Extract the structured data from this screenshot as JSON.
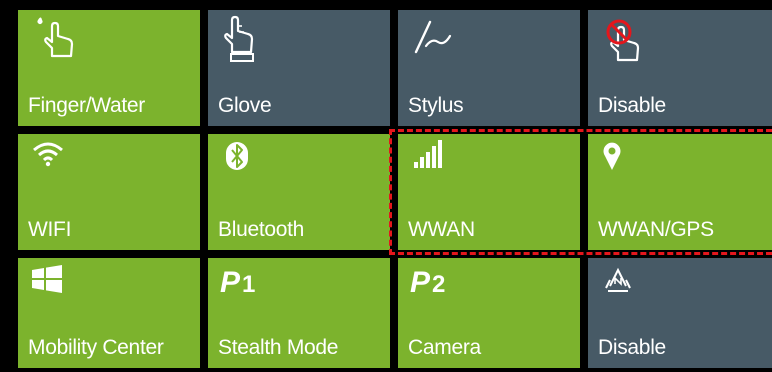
{
  "tiles": {
    "row1": [
      {
        "label": "Finger/Water",
        "icon": "finger-water-icon"
      },
      {
        "label": "Glove",
        "icon": "glove-hand-icon"
      },
      {
        "label": "Stylus",
        "icon": "stylus-icon"
      },
      {
        "label": "Disable",
        "icon": "touch-disabled-icon"
      }
    ],
    "row2": [
      {
        "label": "WIFI",
        "icon": "wifi-icon"
      },
      {
        "label": "Bluetooth",
        "icon": "bluetooth-icon"
      },
      {
        "label": "WWAN",
        "icon": "signal-bars-icon"
      },
      {
        "label": "WWAN/GPS",
        "icon": "location-pin-icon"
      }
    ],
    "row3": [
      {
        "label": "Mobility Center",
        "icon": "windows-icon"
      },
      {
        "label": "Stealth Mode",
        "icon": "p1-icon",
        "glyph": "P",
        "glyph_num": "1"
      },
      {
        "label": "Camera",
        "icon": "p2-icon",
        "glyph": "P",
        "glyph_num": "2"
      },
      {
        "label": "Disable",
        "icon": "nfc-icon"
      }
    ]
  },
  "colors": {
    "enabled": "#7cb32d",
    "disabled": "#475a66",
    "highlight_border": "#e4161c",
    "background": "#000000"
  }
}
